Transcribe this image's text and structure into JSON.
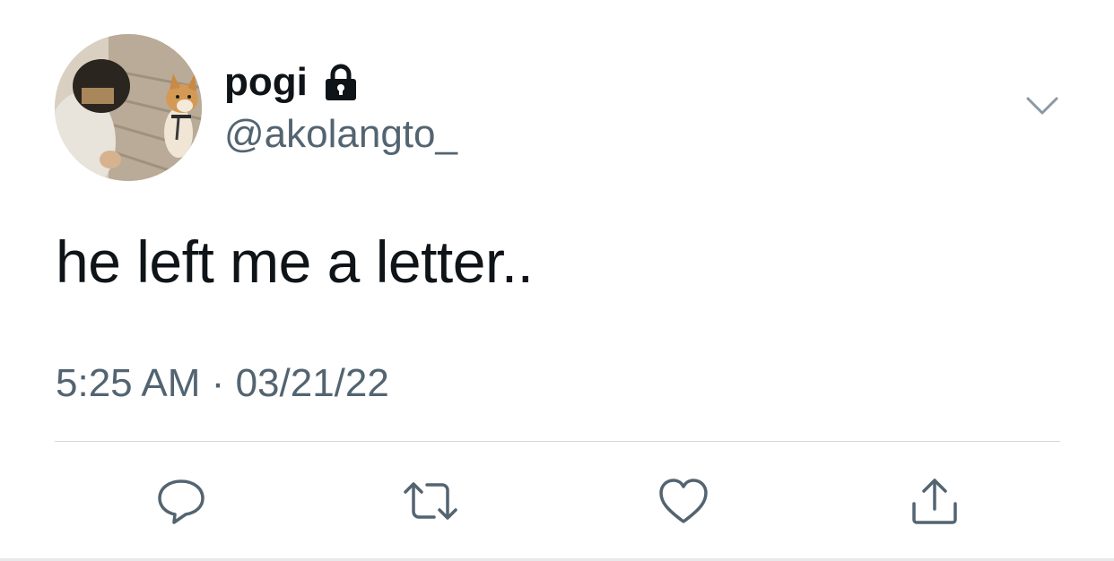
{
  "user": {
    "display_name": "pogi",
    "handle": "@akolangto_",
    "verified_icon": "lock-icon",
    "avatar_icon": "profile-photo"
  },
  "tweet": {
    "text": "he left me a letter..",
    "time": "5:25 AM",
    "separator": "·",
    "date": "03/21/22"
  },
  "actions": [
    {
      "name": "reply",
      "icon": "reply-icon"
    },
    {
      "name": "retweet",
      "icon": "retweet-icon"
    },
    {
      "name": "like",
      "icon": "heart-icon"
    },
    {
      "name": "share",
      "icon": "share-icon"
    }
  ],
  "colors": {
    "text_primary": "#0f1419",
    "text_secondary": "#536471",
    "icon": "#536471",
    "divider": "#d6d9db"
  }
}
